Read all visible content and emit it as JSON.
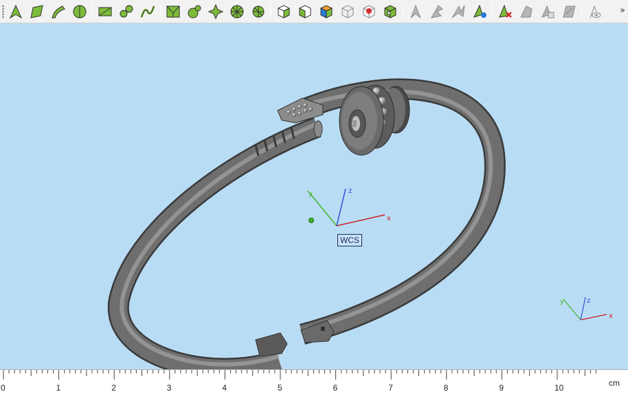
{
  "toolbar": {
    "groups": [
      [
        "sketch-vertex-icon",
        "sketch-face-icon",
        "sketch-sweep-icon",
        "sketch-revolve-icon"
      ],
      [
        "rectangle-face-icon",
        "pipe-icon",
        "curve-icon"
      ],
      [
        "mesh-face-icon",
        "split-icon",
        "pattern-icon",
        "wheel-icon",
        "spoke-icon"
      ],
      [
        "cube-view-icon",
        "cube-front-icon",
        "cube-color-icon",
        "cube-wire-icon",
        "cube-red-icon",
        "cube-green-icon"
      ],
      [
        "arrow-disabled-icon",
        "arrow-split-disabled-icon",
        "arrow-double-icon",
        "arrow-refresh-icon"
      ],
      [
        "delete-red-x-icon",
        "prism-disabled-icon",
        "copy-disabled-icon",
        "panel-disabled-icon"
      ],
      [
        "eye-disabled-icon"
      ]
    ],
    "overflow_label": "»"
  },
  "viewport": {
    "wcs_label": "WCS",
    "main_axes": {
      "x": "x",
      "y": "y",
      "z": "z"
    },
    "corner_axes": {
      "x": "x",
      "y": "y",
      "z": "z"
    },
    "colors": {
      "background": "#b9dcf5",
      "x_axis": "#cc1f1f",
      "y_axis": "#3fb52a",
      "z_axis": "#2a4fd8",
      "model": "#6e6e6e"
    }
  },
  "ruler": {
    "labels": [
      "0",
      "1",
      "2",
      "3",
      "4",
      "5",
      "6",
      "7",
      "8",
      "9",
      "10"
    ],
    "unit": "cm"
  }
}
